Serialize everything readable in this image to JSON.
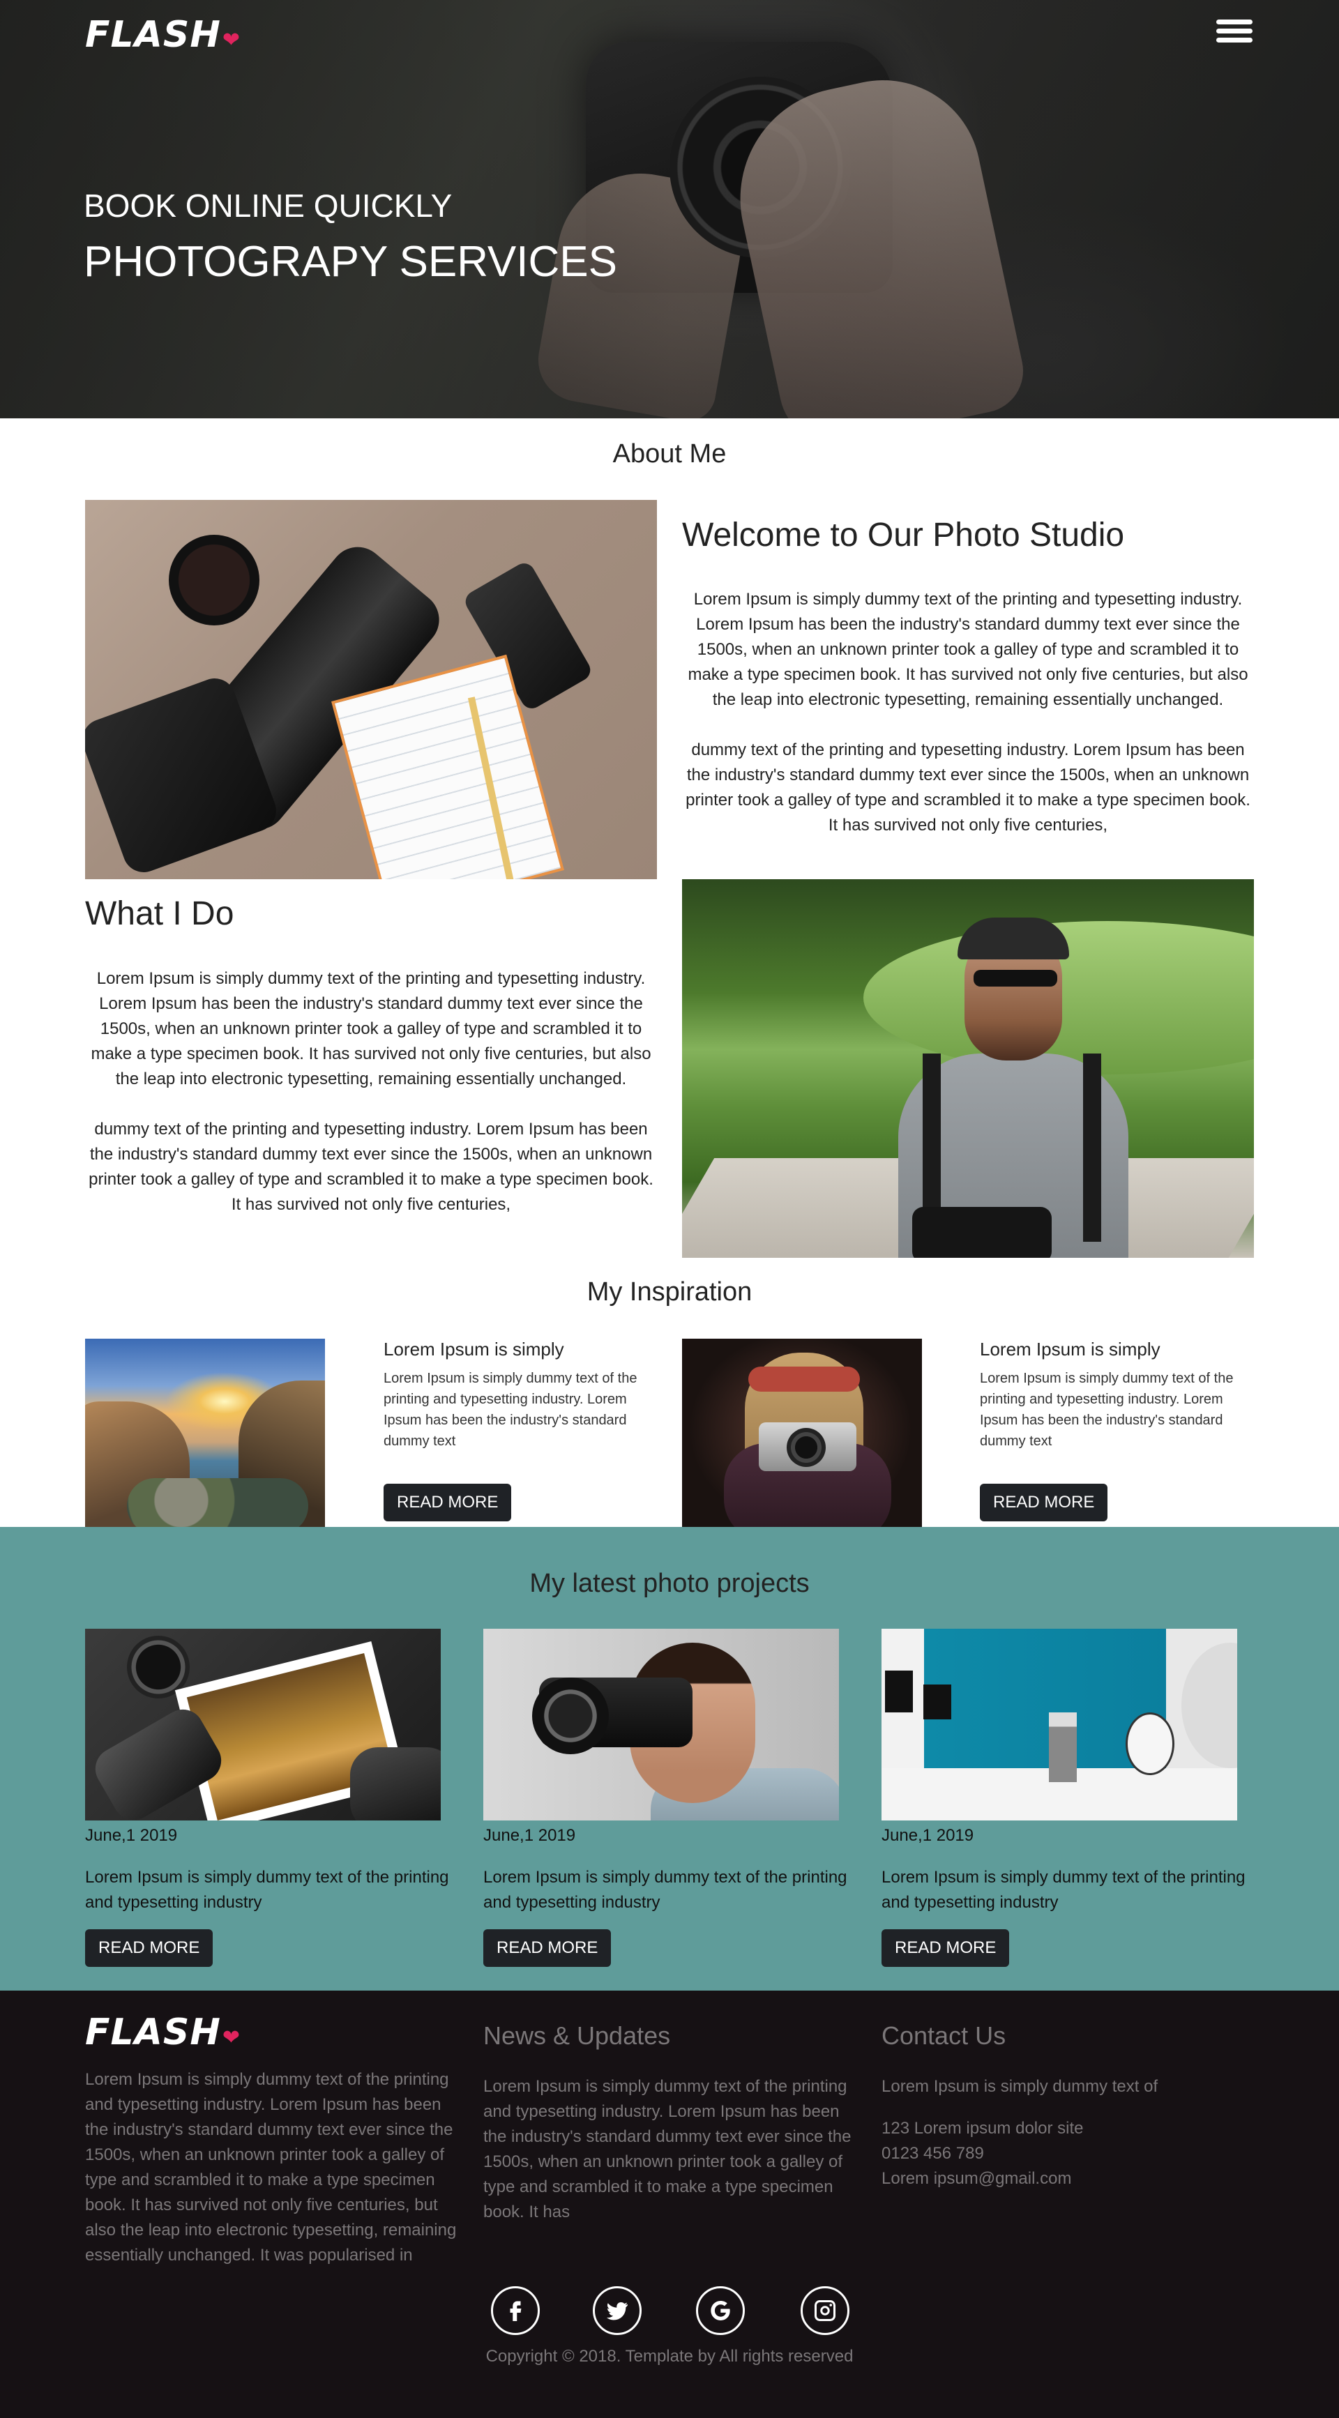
{
  "brand": {
    "logo_text": "FLASH",
    "heart": "❤",
    "heart_color": "#e0245e"
  },
  "hero": {
    "subtitle": "BOOK ONLINE QUICKLY",
    "title": "PHOTOGRAPY SERVICES",
    "menu_icon": "hamburger-menu-icon"
  },
  "about": {
    "section_title": "About Me",
    "welcome_title": "Welcome to Our Photo Studio",
    "welcome_p1": "Lorem Ipsum is simply dummy text of the printing and typesetting industry. Lorem Ipsum has been the industry's standard dummy text ever since the 1500s, when an unknown printer took a galley of type and scrambled it to make a type specimen book. It has survived not only five centuries, but also the leap into electronic typesetting, remaining essentially unchanged.",
    "welcome_p2": "dummy text of the printing and typesetting industry. Lorem Ipsum has been the industry's standard dummy text ever since the 1500s, when an unknown printer took a galley of type and scrambled it to make a type specimen book. It has survived not only five centuries,",
    "what_title": "What I Do",
    "what_p1": "Lorem Ipsum is simply dummy text of the printing and typesetting industry. Lorem Ipsum has been the industry's standard dummy text ever since the 1500s, when an unknown printer took a galley of type and scrambled it to make a type specimen book. It has survived not only five centuries, but also the leap into electronic typesetting, remaining essentially unchanged.",
    "what_p2": "dummy text of the printing and typesetting industry. Lorem Ipsum has been the industry's standard dummy text ever since the 1500s, when an unknown printer took a galley of type and scrambled it to make a type specimen book. It has survived not only five centuries,"
  },
  "inspiration": {
    "section_title": "My Inspiration",
    "items": [
      {
        "heading": "Lorem Ipsum is simply",
        "text": "Lorem Ipsum is simply dummy text of the printing and typesetting industry. Lorem Ipsum has been the industry's standard dummy text",
        "button": "READ MORE"
      },
      {
        "heading": "Lorem Ipsum is simply",
        "text": "Lorem Ipsum is simply dummy text of the printing and typesetting industry. Lorem Ipsum has been the industry's standard dummy text",
        "button": "READ MORE"
      }
    ]
  },
  "projects": {
    "section_title": "My latest photo projects",
    "background_color": "#5f9c9a",
    "items": [
      {
        "date": "June,1 2019",
        "text": "Lorem Ipsum is simply dummy text of the printing and typesetting industry",
        "button": "READ MORE"
      },
      {
        "date": "June,1 2019",
        "text": "Lorem Ipsum is simply dummy text of the printing and typesetting industry",
        "button": "READ MORE"
      },
      {
        "date": "June,1 2019",
        "text": "Lorem Ipsum is simply dummy text of the printing and typesetting industry",
        "button": "READ MORE"
      }
    ]
  },
  "footer": {
    "about_text": "Lorem Ipsum is simply dummy text of the printing and typesetting industry. Lorem Ipsum has been the industry's standard dummy text ever since the 1500s, when an unknown printer took a galley of type and scrambled it to make a type specimen book. It has survived not only five centuries, but also the leap into electronic typesetting, remaining essentially unchanged. It was popularised in",
    "news_title": "News & Updates",
    "news_text": "Lorem Ipsum is simply dummy text of the printing and typesetting industry. Lorem Ipsum has been the industry's standard dummy text ever since the 1500s, when an unknown printer took a galley of type and scrambled it to make a type specimen book. It has",
    "contact_title": "Contact Us",
    "contact_intro": "Lorem Ipsum is simply dummy text of",
    "address": "123 Lorem ipsum dolor site",
    "phone": "0123 456 789",
    "email": "Lorem ipsum@gmail.com",
    "social": [
      "facebook-icon",
      "twitter-icon",
      "google-icon",
      "instagram-icon"
    ],
    "copyright": "Copyright © 2018. Template by All rights reserved"
  }
}
